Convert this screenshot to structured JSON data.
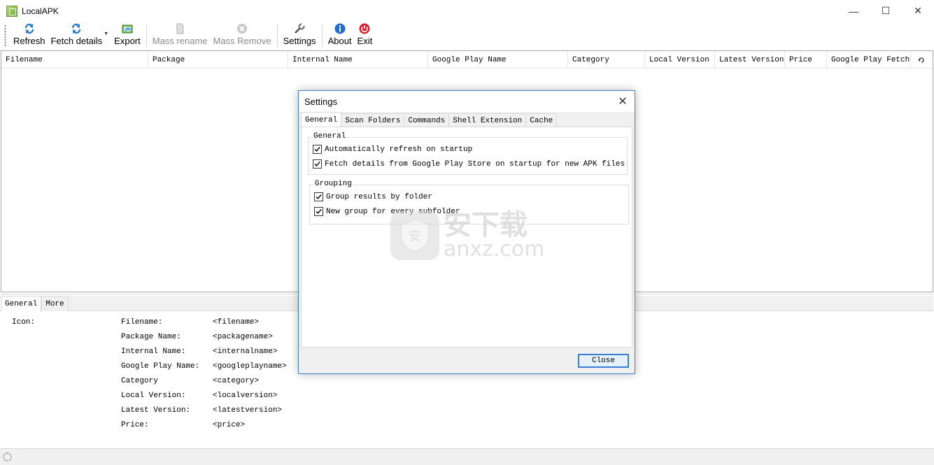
{
  "window": {
    "title": "LocalAPK",
    "controls": {
      "minimize": "—",
      "maximize": "☐",
      "close": "✕"
    }
  },
  "toolbar": {
    "refresh": "Refresh",
    "fetch_details": "Fetch details",
    "export": "Export",
    "mass_rename": "Mass rename",
    "mass_remove": "Mass Remove",
    "settings": "Settings",
    "about": "About",
    "exit": "Exit"
  },
  "list": {
    "columns": [
      "Filename",
      "Package",
      "Internal Name",
      "Google Play Name",
      "Category",
      "Local Version",
      "Latest Version",
      "Price",
      "Google Play Fetch"
    ]
  },
  "details": {
    "tabs": [
      "General",
      "More"
    ],
    "icon_label": "Icon:",
    "fields": [
      {
        "label": "Filename:",
        "value": "<filename>"
      },
      {
        "label": "Package Name:",
        "value": "<packagename>"
      },
      {
        "label": "Internal Name:",
        "value": "<internalname>"
      },
      {
        "label": "Google Play Name:",
        "value": "<googleplayname>"
      },
      {
        "label": "Category",
        "value": "<category>"
      },
      {
        "label": "Local Version:",
        "value": "<localversion>"
      },
      {
        "label": "Latest Version:",
        "value": "<latestversion>"
      },
      {
        "label": "Price:",
        "value": "<price>"
      }
    ]
  },
  "settings_dialog": {
    "title": "Settings",
    "tabs": [
      "General",
      "Scan Folders",
      "Commands",
      "Shell Extension",
      "Cache"
    ],
    "groups": [
      {
        "title": "General",
        "options": [
          {
            "label": "Automatically refresh on startup",
            "checked": true
          },
          {
            "label": "Fetch details from Google Play Store on startup for new APK files",
            "checked": true
          }
        ]
      },
      {
        "title": "Grouping",
        "options": [
          {
            "label": "Group results by folder",
            "checked": true
          },
          {
            "label": "New group for every subfolder",
            "checked": true
          }
        ]
      }
    ],
    "close_button": "Close"
  },
  "watermark": {
    "cn": "安下载",
    "en": "anxz.com",
    "badge": "安"
  },
  "colors": {
    "accent": "#3c7fd0",
    "exit_red": "#d9202a",
    "about_blue": "#1e6fd0"
  }
}
